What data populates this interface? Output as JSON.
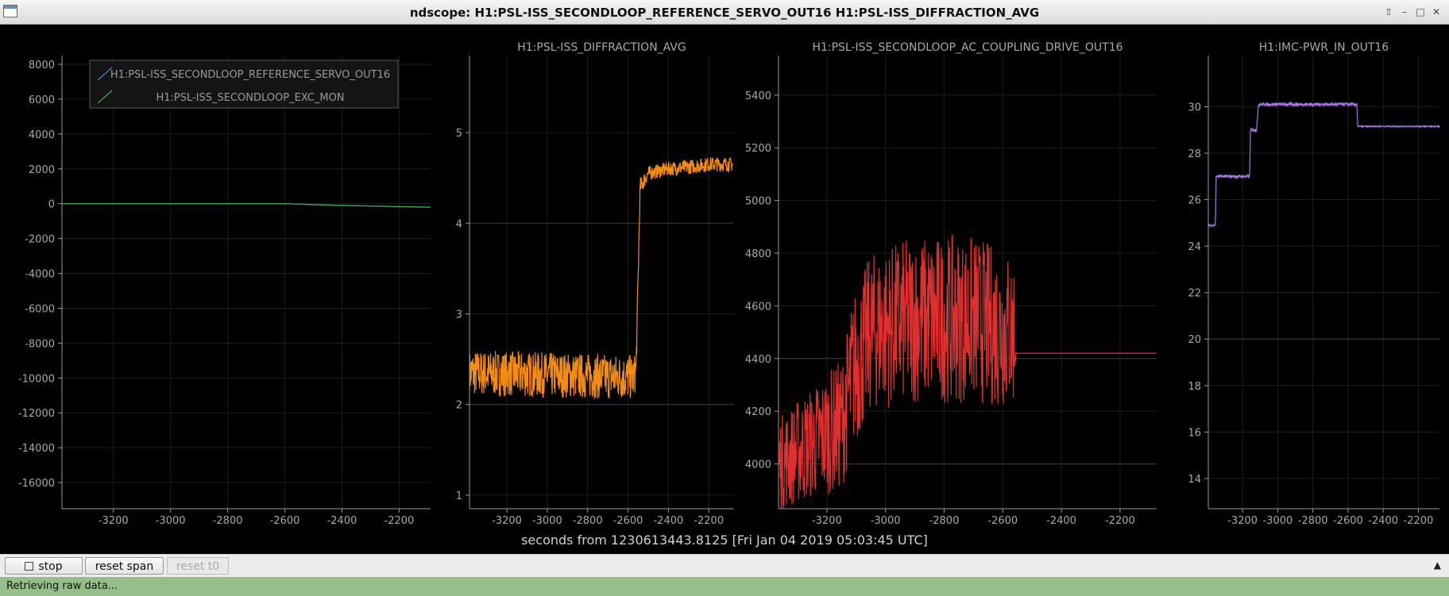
{
  "window": {
    "title": "ndscope: H1:PSL-ISS_SECONDLOOP_REFERENCE_SERVO_OUT16 H1:PSL-ISS_DIFFRACTION_AVG"
  },
  "xlabel": "seconds from 1230613443.8125 [Fri Jan 04 2019 05:03:45 UTC]",
  "toolbar": {
    "stop_label": "stop",
    "reset_span_label": "reset span",
    "reset_t0_label": "reset t0"
  },
  "status": {
    "text": "Retrieving raw data..."
  },
  "colors": {
    "blue": "#3d86d4",
    "green": "#2fb544",
    "orange": "#f28c13",
    "red": "#e02f2f",
    "purple": "#a775e6"
  },
  "chart_data": [
    {
      "type": "line",
      "title": "",
      "xlim": [
        -3380,
        -2090
      ],
      "ylim": [
        -17500,
        8500
      ],
      "xticks": [
        -3200,
        -3000,
        -2800,
        -2600,
        -2400,
        -2200
      ],
      "yticks": [
        8000,
        6000,
        4000,
        2000,
        0,
        -2000,
        -4000,
        -6000,
        -8000,
        -10000,
        -12000,
        -14000,
        -16000
      ],
      "legend": "top-left",
      "series": [
        {
          "name": "H1:PSL-ISS_SECONDLOOP_REFERENCE_SERVO_OUT16",
          "color": "#3d86d4",
          "x": [
            -3380,
            -2600,
            -2400,
            -2090
          ],
          "y": [
            0,
            0,
            -100,
            -200
          ]
        },
        {
          "name": "H1:PSL-ISS_SECONDLOOP_EXC_MON",
          "color": "#2fb544",
          "x": [
            -3380,
            -2600,
            -2400,
            -2090
          ],
          "y": [
            0,
            0,
            -100,
            -200
          ]
        }
      ]
    },
    {
      "type": "line",
      "title": "H1:PSL-ISS_DIFFRACTION_AVG",
      "xlim": [
        -3385,
        -2075
      ],
      "ylim": [
        0.85,
        5.85
      ],
      "xticks": [
        -3200,
        -3000,
        -2800,
        -2600,
        -2400,
        -2200
      ],
      "yticks": [
        5,
        4,
        3,
        2,
        1
      ],
      "grid_y": [
        4,
        2
      ],
      "series": [
        {
          "color": "#f28c13",
          "x": [
            -3385,
            -2570,
            -2560,
            -2540,
            -2500,
            -2400,
            -2300,
            -2200,
            -2080
          ],
          "y": [
            2.35,
            2.3,
            2.4,
            4.4,
            4.55,
            4.6,
            4.62,
            4.65,
            4.65
          ],
          "noise": [
            0.25,
            0.25,
            0.2,
            0.1,
            0.08,
            0.08,
            0.08,
            0.08,
            0.08
          ]
        }
      ]
    },
    {
      "type": "line",
      "title": "H1:PSL-ISS_SECONDLOOP_AC_COUPLING_DRIVE_OUT16",
      "xlim": [
        -3365,
        -2075
      ],
      "ylim": [
        3830,
        5550
      ],
      "xticks": [
        -3200,
        -3000,
        -2800,
        -2600,
        -2400,
        -2200
      ],
      "yticks": [
        5400,
        5200,
        5000,
        4800,
        4600,
        4400,
        4200,
        4000
      ],
      "grid_y": [
        4400,
        4000
      ],
      "series": [
        {
          "color": "#e02f2f",
          "x": [
            -3365,
            -3150,
            -3110,
            -3050,
            -2900,
            -2700,
            -2560,
            -2555,
            -2075
          ],
          "y": [
            4000,
            4150,
            4350,
            4500,
            4550,
            4550,
            4500,
            4420,
            4420
          ],
          "noise": [
            180,
            250,
            300,
            300,
            320,
            320,
            300,
            0,
            0
          ]
        }
      ]
    },
    {
      "type": "line",
      "title": "H1:IMC-PWR_IN_OUT16",
      "xlim": [
        -3395,
        -2080
      ],
      "ylim": [
        12.7,
        32.2
      ],
      "xticks": [
        -3200,
        -3000,
        -2800,
        -2600,
        -2400,
        -2200
      ],
      "yticks": [
        30,
        28,
        26,
        24,
        22,
        20,
        18,
        16,
        14
      ],
      "grid_y": [
        20
      ],
      "series": [
        {
          "color": "#a775e6",
          "x": [
            -3395,
            -3355,
            -3350,
            -3160,
            -3155,
            -3120,
            -3110,
            -2550,
            -2545,
            -2080
          ],
          "y": [
            24.9,
            24.9,
            27.0,
            27.0,
            29.0,
            29.0,
            30.1,
            30.1,
            29.15,
            29.15
          ],
          "noise": [
            0.05,
            0.05,
            0.06,
            0.06,
            0.08,
            0.08,
            0.07,
            0.07,
            0.02,
            0.02
          ]
        }
      ]
    }
  ]
}
